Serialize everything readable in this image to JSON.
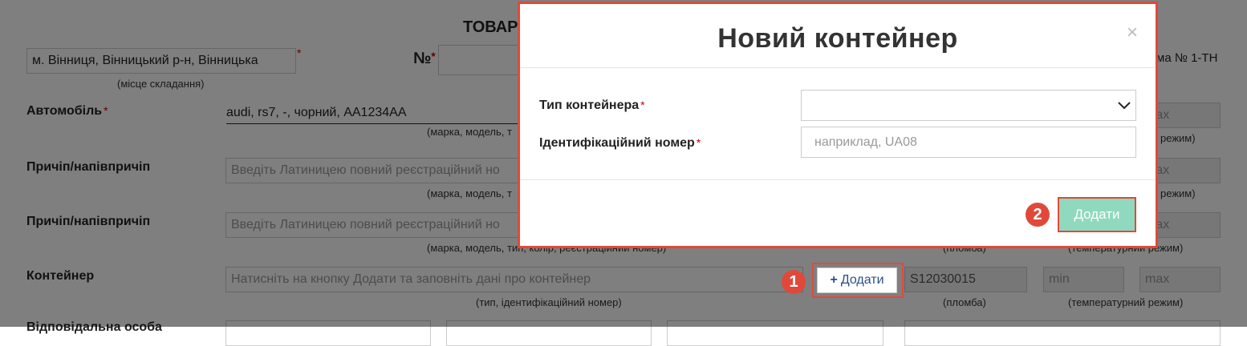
{
  "form": {
    "title": "ТОВАР",
    "place_value": "м. Вінниця, Вінницький р-н, Вінницька",
    "place_hint": "(місце складання)",
    "number_label": "№",
    "form_caption": "ма № 1-ТН",
    "rows": [
      {
        "label": "Автомобіль",
        "value": "audi, rs7, -, чорний, AA1234AA",
        "hint": "(марка, модель, т",
        "max_placeholder": "max",
        "temp_hint": "режим)"
      },
      {
        "label": "Причіп/напівпричіп",
        "placeholder": "Введіть Латиницею повний реєстраційний но",
        "hint": "(марка, модель, т",
        "max_placeholder": "max",
        "temp_hint": "режим)"
      },
      {
        "label": "Причіп/напівпричіп",
        "placeholder": "Введіть Латиницею повний реєстраційний но",
        "hint": "(марка, модель, тип, колір, реєстраційний номер)",
        "seal_hint": "(пломба)",
        "temp_hint": "(температурний режим)",
        "max_placeholder": "max"
      },
      {
        "label": "Контейнер",
        "placeholder": "Натисніть на кнопку Додати та заповніть дані про контейнер",
        "add_label": "Додати",
        "seal_value": "S12030015",
        "min_placeholder": "min",
        "max_placeholder": "max",
        "hint": "(тип, ідентифікаційний номер)",
        "seal_hint": "(пломба)",
        "temp_hint": "(температурний режим)"
      }
    ],
    "bottom_label_partial": "Відповідальна особа"
  },
  "modal": {
    "title": "Новий контейнер",
    "close": "×",
    "type_label": "Тип контейнера",
    "id_label": "Ідентифікаційний номер",
    "required_mark": "*",
    "id_placeholder": "наприклад, UA08",
    "add_button": "Додати"
  },
  "callouts": {
    "one": "1",
    "two": "2"
  },
  "colors": {
    "accent": "#e0493a",
    "button": "#8fd9bf",
    "link": "#2b4f85"
  }
}
